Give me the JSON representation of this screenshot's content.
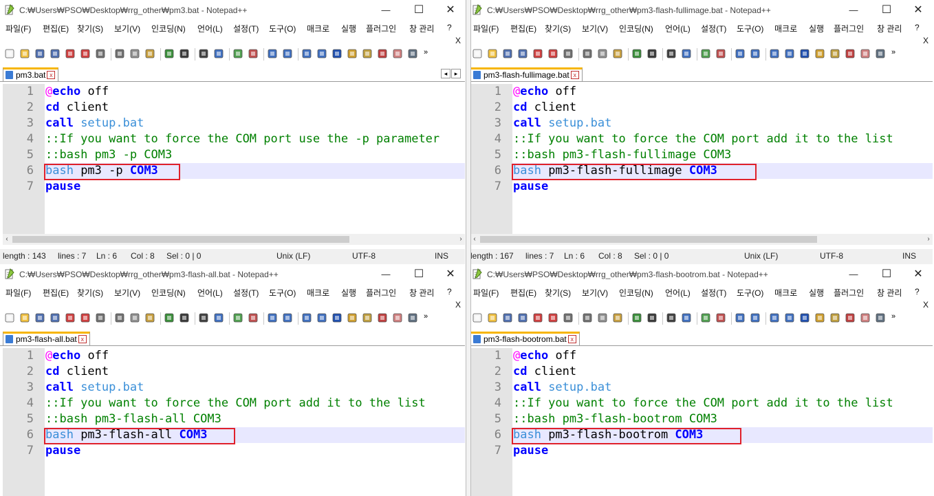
{
  "menu": [
    "파일(F)",
    "편집(E)",
    "찾기(S)",
    "보기(V)",
    "인코딩(N)",
    "언어(L)",
    "설정(T)",
    "도구(O)",
    "매크로",
    "실행",
    "플러그인",
    "창 관리",
    "?"
  ],
  "menu_close": "X",
  "window_controls": {
    "minimize": "—",
    "maximize": "☐",
    "close": "✕"
  },
  "windows": [
    {
      "title": "C:₩Users₩PSO₩Desktop₩rrg_other₩pm3.bat - Notepad++",
      "tab": "pm3.bat",
      "tab_close": "x",
      "lines": [
        "1",
        "2",
        "3",
        "4",
        "5",
        "6",
        "7"
      ],
      "code_line4": "::If you want to force the COM port use the -p parameter",
      "code_line5": "::bash pm3 -p COM3",
      "code_line6_arg": " pm3 -p ",
      "status": {
        "length": "length : 143",
        "lines": "lines : 7",
        "ln": "Ln : 6",
        "col": "Col : 8",
        "sel": "Sel : 0 | 0",
        "eol": "Unix (LF)",
        "enc": "UTF-8",
        "ins": "INS"
      }
    },
    {
      "title": "C:₩Users₩PSO₩Desktop₩rrg_other₩pm3-flash-fullimage.bat - Notepad++",
      "tab": "pm3-flash-fullimage.bat",
      "tab_close": "x",
      "lines": [
        "1",
        "2",
        "3",
        "4",
        "5",
        "6",
        "7"
      ],
      "code_line4": "::If you want to force the COM port add it to the list",
      "code_line5": "::bash pm3-flash-fullimage COM3",
      "code_line6_arg": " pm3-flash-fullimage ",
      "status": {
        "length": "length : 167",
        "lines": "lines : 7",
        "ln": "Ln : 6",
        "col": "Col : 8",
        "sel": "Sel : 0 | 0",
        "eol": "Unix (LF)",
        "enc": "UTF-8",
        "ins": "INS"
      }
    },
    {
      "title": "C:₩Users₩PSO₩Desktop₩rrg_other₩pm3-flash-all.bat - Notepad++",
      "tab": "pm3-flash-all.bat",
      "tab_close": "x",
      "lines": [
        "1",
        "2",
        "3",
        "4",
        "5",
        "6",
        "7"
      ],
      "code_line4": "::If you want to force the COM port add it to the list",
      "code_line5": "::bash pm3-flash-all COM3",
      "code_line6_arg": " pm3-flash-all ",
      "status": null
    },
    {
      "title": "C:₩Users₩PSO₩Desktop₩rrg_other₩pm3-flash-bootrom.bat - Notepad++",
      "tab": "pm3-flash-bootrom.bat",
      "tab_close": "x",
      "lines": [
        "1",
        "2",
        "3",
        "4",
        "5",
        "6",
        "7"
      ],
      "code_line4": "::If you want to force the COM port add it to the list",
      "code_line5": "::bash pm3-flash-bootrom COM3",
      "code_line6_arg": " pm3-flash-bootrom ",
      "status": null
    }
  ],
  "code_common": {
    "at": "@",
    "echo": "echo",
    "off": " off",
    "cd": "cd",
    "client": " client",
    "call": "call",
    "setup": " setup.bat",
    "bash": "bash",
    "com3": "COM3",
    "pause": "pause"
  },
  "colors": {
    "keyword": "#0000ff",
    "comment": "#008000",
    "at": "#ff00ff",
    "file": "#3a8fd8",
    "highlight_box": "#e0202a",
    "current_line": "#e8e8ff",
    "tab_accent": "#f7b500"
  }
}
